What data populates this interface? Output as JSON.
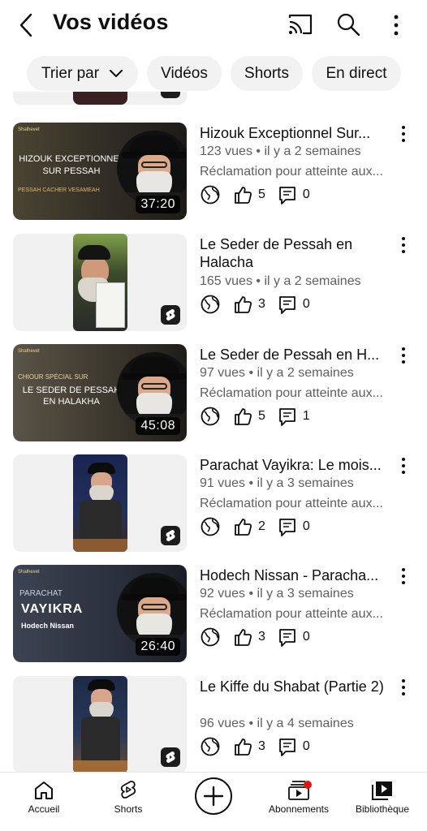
{
  "header": {
    "title": "Vos vidéos"
  },
  "chips": {
    "sort": "Trier par",
    "videos": "Vidéos",
    "shorts": "Shorts",
    "live": "En direct"
  },
  "items": [
    {
      "kind": "video",
      "title": "Hizouk Exceptionnel Sur...",
      "views": "123 vues",
      "age": "il y a 2 semaines",
      "claim": "Réclamation pour atteinte aux...",
      "likes": "5",
      "comments": "0",
      "duration": "37:20",
      "thumb_lines": [
        "HIZOUK EXCEPTIONNEL",
        "SUR PESSAH"
      ],
      "thumb_small": "PESSAH CACHER VESAMEAH",
      "thumb_logo": "Shalhevet"
    },
    {
      "kind": "short",
      "title": "Le Seder de Pessah en Halacha",
      "views": "165 vues",
      "age": "il y a 2 semaines",
      "claim": "",
      "likes": "3",
      "comments": "0"
    },
    {
      "kind": "video",
      "title": "Le Seder de Pessah en H...",
      "views": "97 vues",
      "age": "il y a 2 semaines",
      "claim": "Réclamation pour atteinte aux...",
      "likes": "5",
      "comments": "1",
      "duration": "45:08",
      "thumb_lines": [
        "LE SEDER DE PESSAH",
        "EN HALAKHA"
      ],
      "thumb_small": "CHIOUR SPÉCIAL SUR",
      "thumb_logo": "Shalhevet"
    },
    {
      "kind": "short",
      "title": "Parachat Vayikra: Le mois...",
      "views": "91 vues",
      "age": "il y a 3 semaines",
      "claim": "Réclamation pour atteinte aux...",
      "likes": "2",
      "comments": "0"
    },
    {
      "kind": "video",
      "title": "Hodech Nissan - Paracha...",
      "views": "92 vues",
      "age": "il y a 3 semaines",
      "claim": "Réclamation pour atteinte aux...",
      "likes": "3",
      "comments": "0",
      "duration": "26:40",
      "thumb_lines": [
        "VAYIKRA",
        "Hodech Nissan"
      ],
      "thumb_small": "PARACHAT",
      "thumb_logo": "Shalhevet"
    },
    {
      "kind": "short",
      "title": "Le Kiffe du Shabat (Partie 2)",
      "views": "96 vues",
      "age": "il y a 4 semaines",
      "claim": "",
      "likes": "3",
      "comments": "0"
    }
  ],
  "nav": {
    "home": "Accueil",
    "shorts": "Shorts",
    "subs": "Abonnements",
    "library": "Bibliothèque"
  },
  "colors": {
    "notif": "#e51414",
    "meta": "#606060",
    "chip_bg": "#f2f2f2"
  }
}
